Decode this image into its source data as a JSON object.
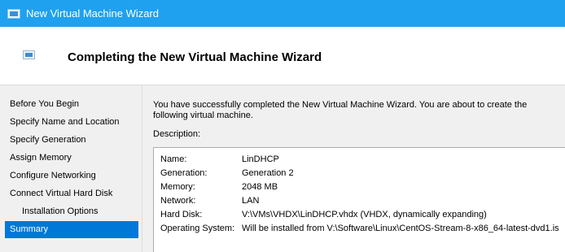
{
  "window": {
    "title": "New Virtual Machine Wizard"
  },
  "header": {
    "title": "Completing the New Virtual Machine Wizard"
  },
  "sidebar": {
    "items": [
      {
        "label": "Before You Begin"
      },
      {
        "label": "Specify Name and Location"
      },
      {
        "label": "Specify Generation"
      },
      {
        "label": "Assign Memory"
      },
      {
        "label": "Configure Networking"
      },
      {
        "label": "Connect Virtual Hard Disk"
      },
      {
        "label": "Installation Options"
      },
      {
        "label": "Summary"
      }
    ],
    "selected": "Summary"
  },
  "main": {
    "intro_line1": "You have successfully completed the New Virtual Machine Wizard. You are about to create the",
    "intro_line2": "following virtual machine.",
    "description_label": "Description:",
    "description": [
      {
        "key": "Name:",
        "value": "LinDHCP"
      },
      {
        "key": "Generation:",
        "value": "Generation 2"
      },
      {
        "key": "Memory:",
        "value": "2048 MB"
      },
      {
        "key": "Network:",
        "value": "LAN"
      },
      {
        "key": "Hard Disk:",
        "value": "V:\\VMs\\VHDX\\LinDHCP.vhdx (VHDX, dynamically expanding)"
      },
      {
        "key": "Operating System:",
        "value": "Will be installed from V:\\Software\\Linux\\CentOS-Stream-8-x86_64-latest-dvd1.is"
      }
    ]
  },
  "colors": {
    "titlebar": "#1fa1ef",
    "selection": "#0078d7",
    "panel_background": "#f0f0f0"
  },
  "icons": {
    "title": "virtual-machine-icon",
    "header": "virtual-machine-icon"
  }
}
